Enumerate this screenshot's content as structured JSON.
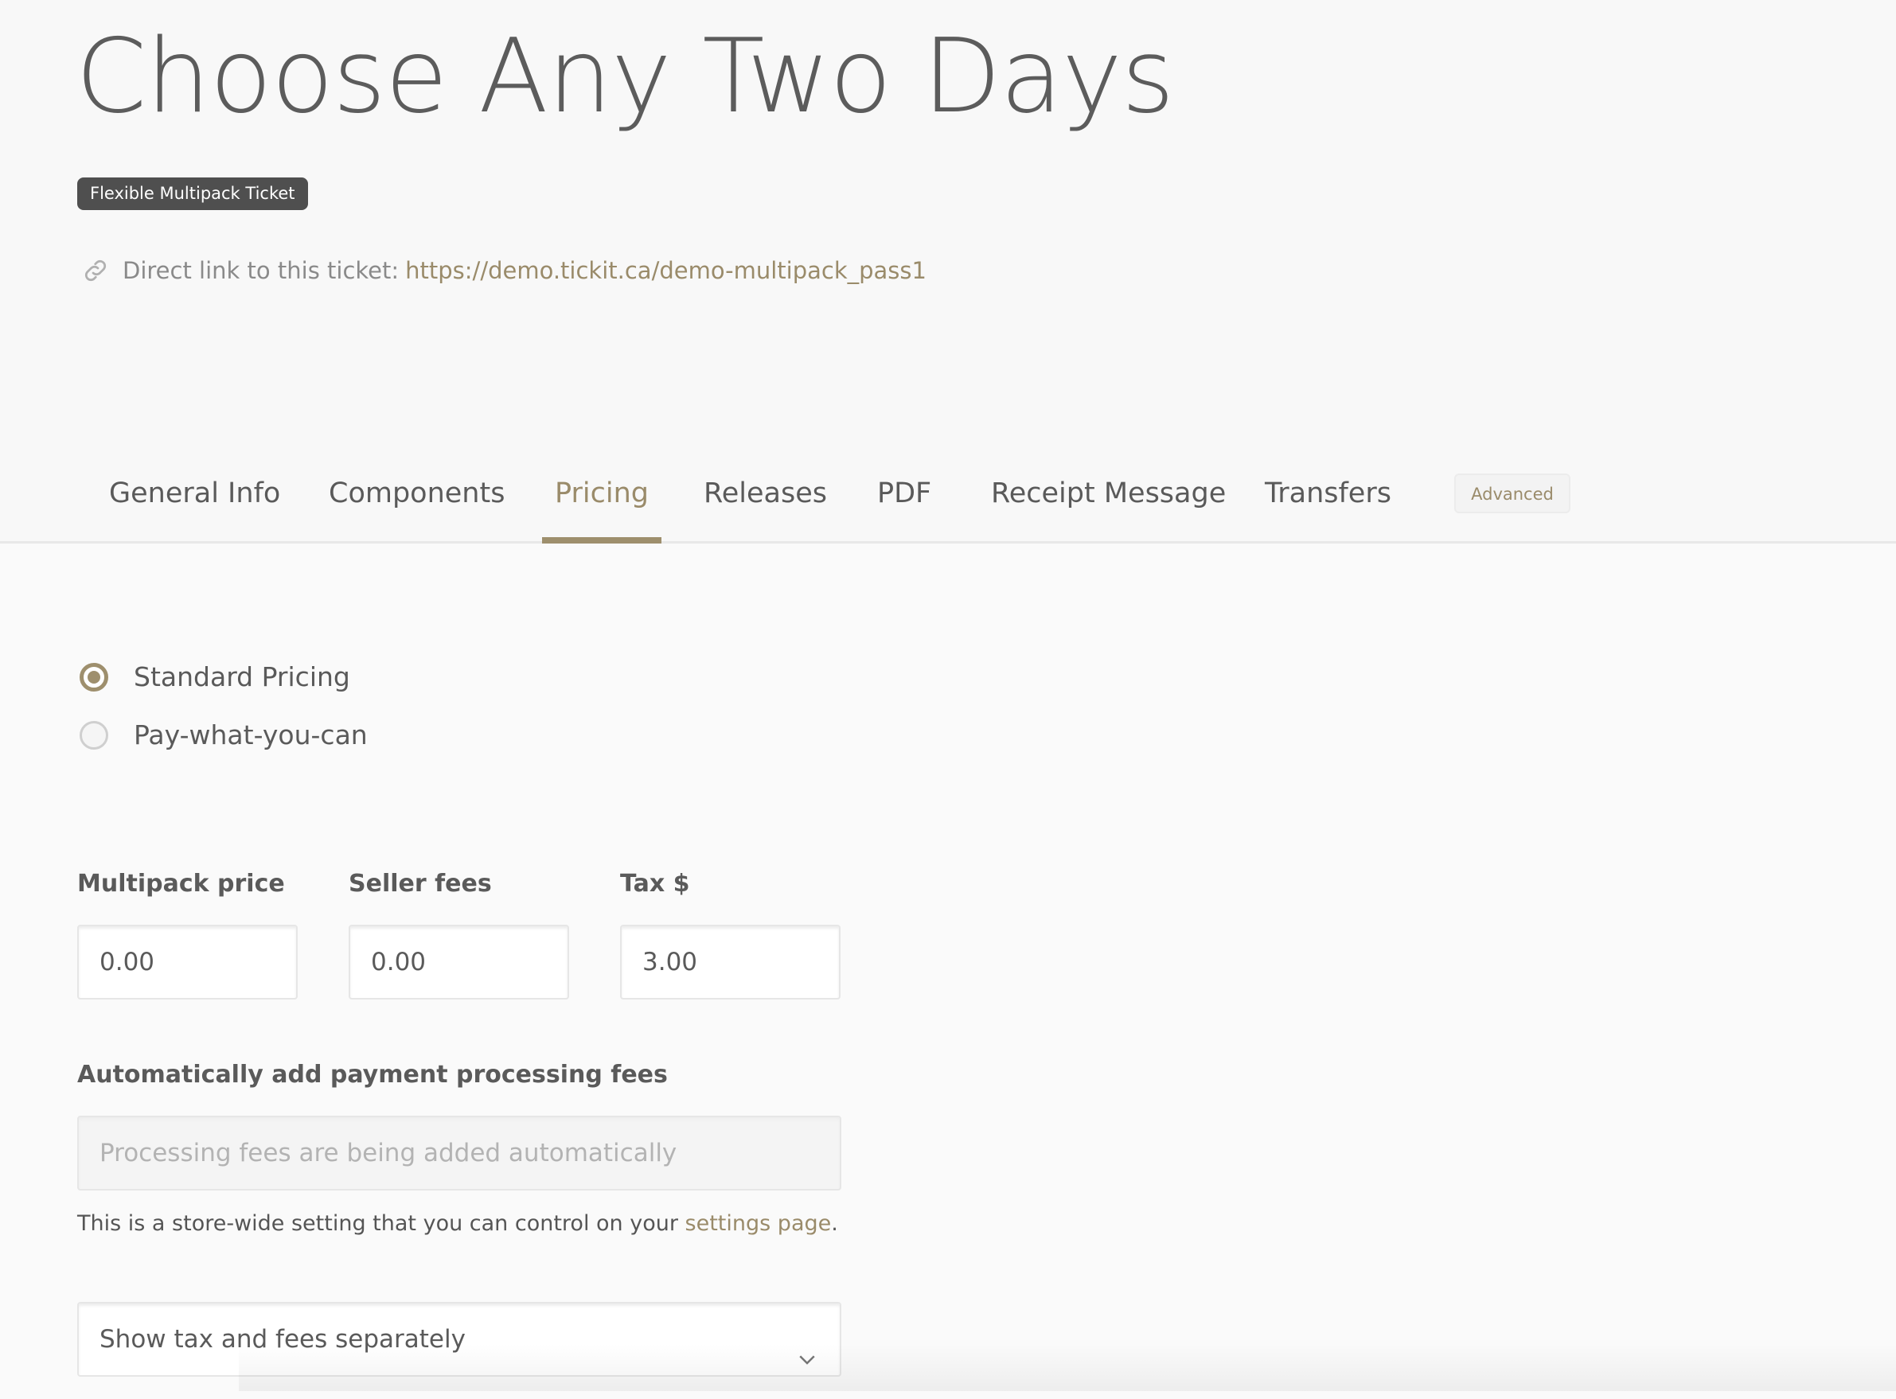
{
  "header": {
    "title": "Choose Any Two Days",
    "badge": "Flexible Multipack Ticket",
    "direct_link_label": "Direct link to this ticket:",
    "direct_link_url": "https://demo.tickit.ca/demo-multipack_pass1",
    "link_icon": "link-icon"
  },
  "tabs": [
    {
      "label": "General Info",
      "active": false
    },
    {
      "label": "Components",
      "active": false
    },
    {
      "label": "Pricing",
      "active": true
    },
    {
      "label": "Releases",
      "active": false
    },
    {
      "label": "PDF",
      "active": false
    },
    {
      "label": "Receipt Message",
      "active": false
    },
    {
      "label": "Transfers",
      "active": false
    }
  ],
  "advanced_button": "Advanced",
  "pricing_mode": {
    "options": [
      {
        "label": "Standard Pricing",
        "checked": true
      },
      {
        "label": "Pay-what-you-can",
        "checked": false
      }
    ]
  },
  "fields": {
    "multipack_price": {
      "label": "Multipack price",
      "value": "0.00"
    },
    "seller_fees": {
      "label": "Seller fees",
      "value": "0.00"
    },
    "tax": {
      "label": "Tax $",
      "value": "3.00"
    }
  },
  "processing_fees": {
    "label": "Automatically add payment processing fees",
    "placeholder": "Processing fees are being added automatically",
    "help_text": "This is a store-wide setting that you can control on your ",
    "help_link": "settings page",
    "help_suffix": "."
  },
  "display_select": {
    "selected": "Show tax and fees separately",
    "icon": "chevron-down-icon"
  },
  "colors": {
    "accent": "#9e8f6d",
    "badge_bg": "#4f4f4f",
    "text": "#5a5a5a"
  }
}
